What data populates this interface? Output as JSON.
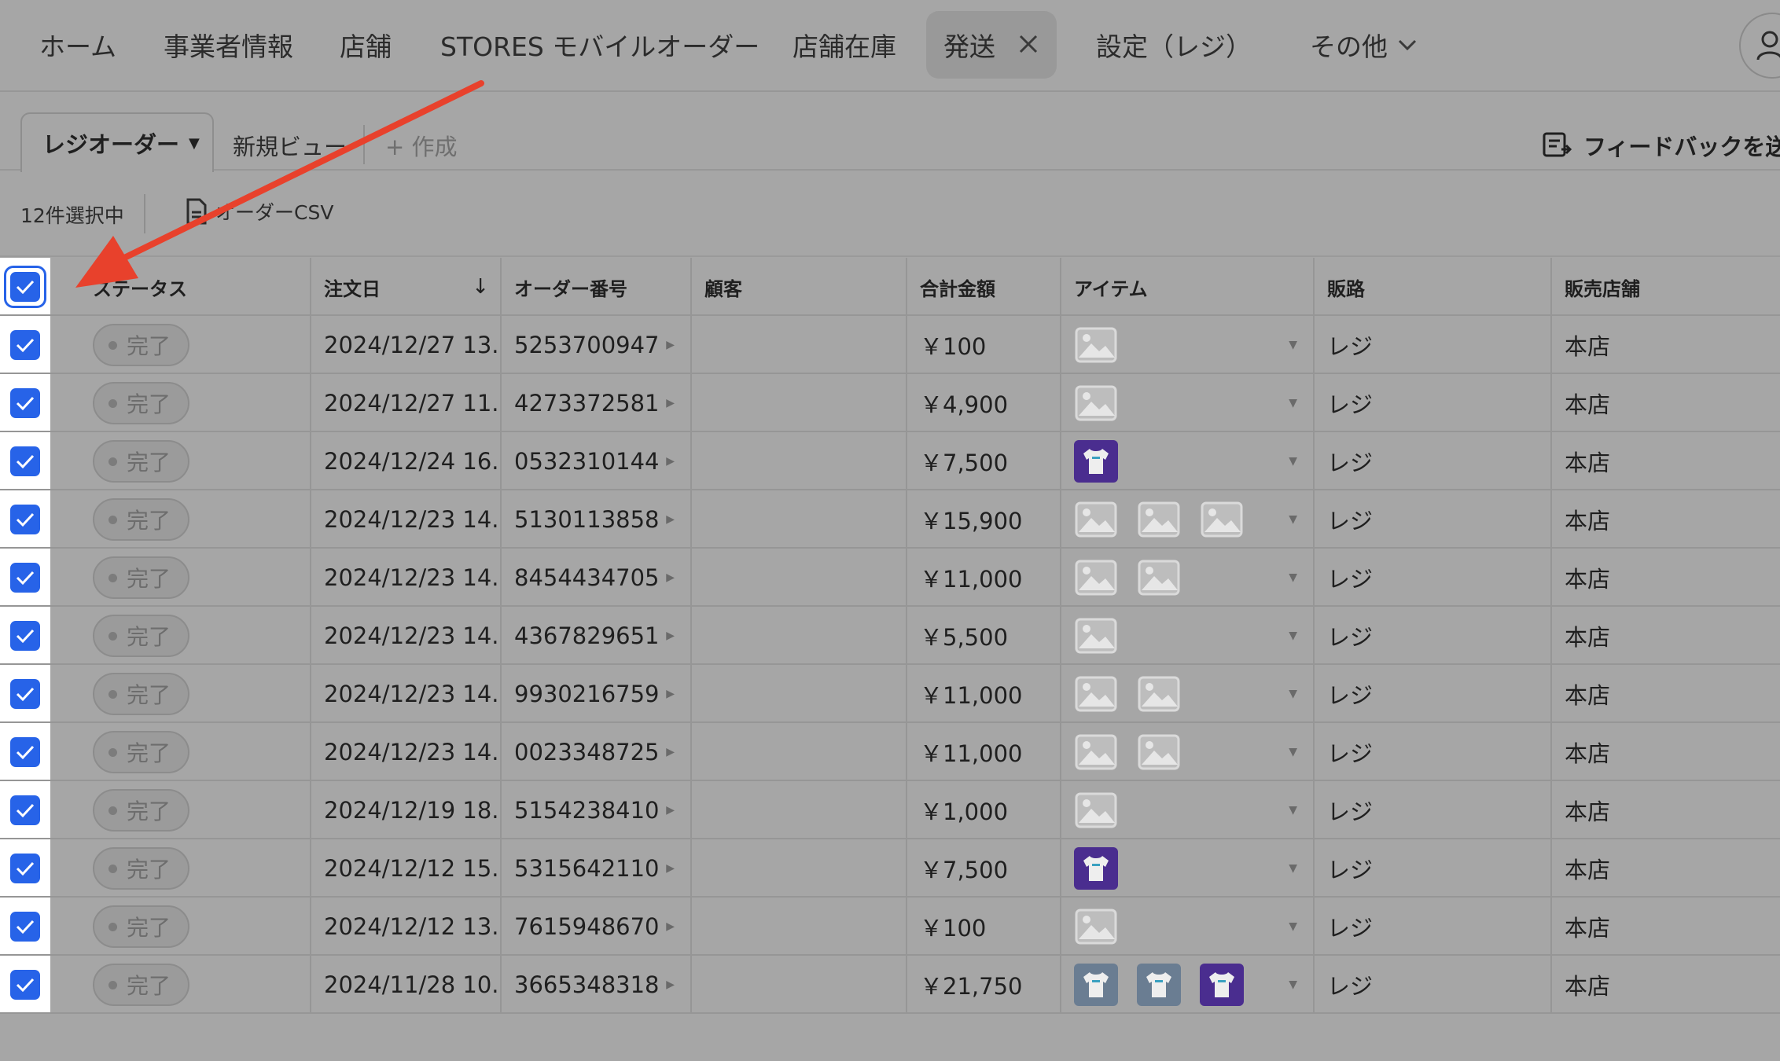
{
  "nav": {
    "items": [
      "ホーム",
      "事業者情報",
      "店舗",
      "STORES モバイルオーダー",
      "店舗在庫",
      "発送",
      "設定（レジ）",
      "その他"
    ],
    "active_index": 5
  },
  "views": {
    "active": "レジオーダー",
    "new_view": "新規ビュー",
    "create": "+ 作成",
    "feedback": "フィードバックを送"
  },
  "actions": {
    "selected_count": "12件選択中",
    "csv": "オーダーCSV"
  },
  "table": {
    "headers": {
      "status": "ステータス",
      "date": "注文日",
      "order": "オーダー番号",
      "customer": "顧客",
      "total": "合計金額",
      "items": "アイテム",
      "channel": "販路",
      "store": "販売店舗"
    },
    "rows": [
      {
        "status": "完了",
        "date": "2024/12/27 13...",
        "order": "5253700947",
        "customer": "",
        "total": "￥100",
        "items": [
          "image"
        ],
        "channel": "レジ",
        "store": "本店",
        "checked": true
      },
      {
        "status": "完了",
        "date": "2024/12/27 11...",
        "order": "4273372581",
        "customer": "",
        "total": "￥4,900",
        "items": [
          "image"
        ],
        "channel": "レジ",
        "store": "本店",
        "checked": true
      },
      {
        "status": "完了",
        "date": "2024/12/24 16...",
        "order": "0532310144",
        "customer": "",
        "total": "￥7,500",
        "items": [
          "shirt-purple"
        ],
        "channel": "レジ",
        "store": "本店",
        "checked": true
      },
      {
        "status": "完了",
        "date": "2024/12/23 14...",
        "order": "5130113858",
        "customer": "",
        "total": "￥15,900",
        "items": [
          "image",
          "image",
          "image"
        ],
        "channel": "レジ",
        "store": "本店",
        "checked": true
      },
      {
        "status": "完了",
        "date": "2024/12/23 14...",
        "order": "8454434705",
        "customer": "",
        "total": "￥11,000",
        "items": [
          "image",
          "image"
        ],
        "channel": "レジ",
        "store": "本店",
        "checked": true
      },
      {
        "status": "完了",
        "date": "2024/12/23 14...",
        "order": "4367829651",
        "customer": "",
        "total": "￥5,500",
        "items": [
          "image"
        ],
        "channel": "レジ",
        "store": "本店",
        "checked": true
      },
      {
        "status": "完了",
        "date": "2024/12/23 14...",
        "order": "9930216759",
        "customer": "",
        "total": "￥11,000",
        "items": [
          "image",
          "image"
        ],
        "channel": "レジ",
        "store": "本店",
        "checked": true
      },
      {
        "status": "完了",
        "date": "2024/12/23 14...",
        "order": "0023348725",
        "customer": "",
        "total": "￥11,000",
        "items": [
          "image",
          "image"
        ],
        "channel": "レジ",
        "store": "本店",
        "checked": true
      },
      {
        "status": "完了",
        "date": "2024/12/19 18...",
        "order": "5154238410",
        "customer": "",
        "total": "￥1,000",
        "items": [
          "image"
        ],
        "channel": "レジ",
        "store": "本店",
        "checked": true
      },
      {
        "status": "完了",
        "date": "2024/12/12 15...",
        "order": "5315642110",
        "customer": "",
        "total": "￥7,500",
        "items": [
          "shirt-purple"
        ],
        "channel": "レジ",
        "store": "本店",
        "checked": true
      },
      {
        "status": "完了",
        "date": "2024/12/12 13...",
        "order": "7615948670",
        "customer": "",
        "total": "￥100",
        "items": [
          "image"
        ],
        "channel": "レジ",
        "store": "本店",
        "checked": true
      },
      {
        "status": "完了",
        "date": "2024/11/28 10...",
        "order": "3665348318",
        "customer": "",
        "total": "￥21,750",
        "items": [
          "shirt-grey",
          "shirt-grey",
          "shirt-purple"
        ],
        "channel": "レジ",
        "store": "本店",
        "checked": true
      }
    ]
  },
  "colors": {
    "checkbox": "#2763e8",
    "annotation_arrow": "#e8412c",
    "shirt_purple": "#4a2d8f"
  }
}
